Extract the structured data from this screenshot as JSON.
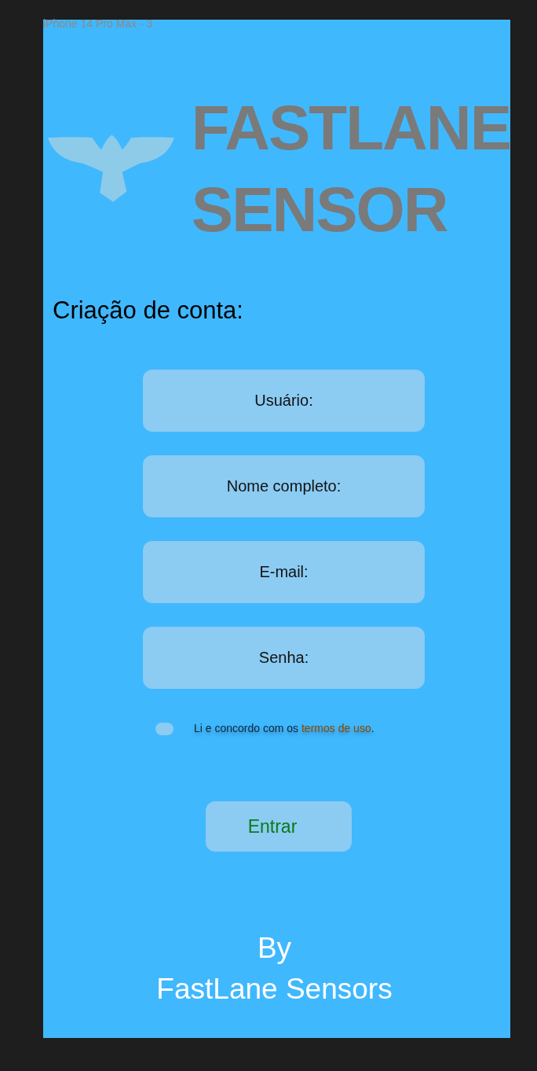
{
  "window": {
    "title": "iPhone 14 Pro Max - 3"
  },
  "logo": {
    "lines": [
      "FASTLANE",
      "SENSOR"
    ]
  },
  "heading": "Criação de conta:",
  "fields": [
    {
      "placeholder": "Usuário:"
    },
    {
      "placeholder": "Nome completo:"
    },
    {
      "placeholder": "E-mail:"
    },
    {
      "placeholder": "Senha:"
    }
  ],
  "terms": {
    "checked": false,
    "text": "Li e concordo com os ",
    "link": "termos de uso",
    "suffix": "."
  },
  "submit_button": "Entrar",
  "footer": [
    "By",
    "FastLane Sensors"
  ]
}
